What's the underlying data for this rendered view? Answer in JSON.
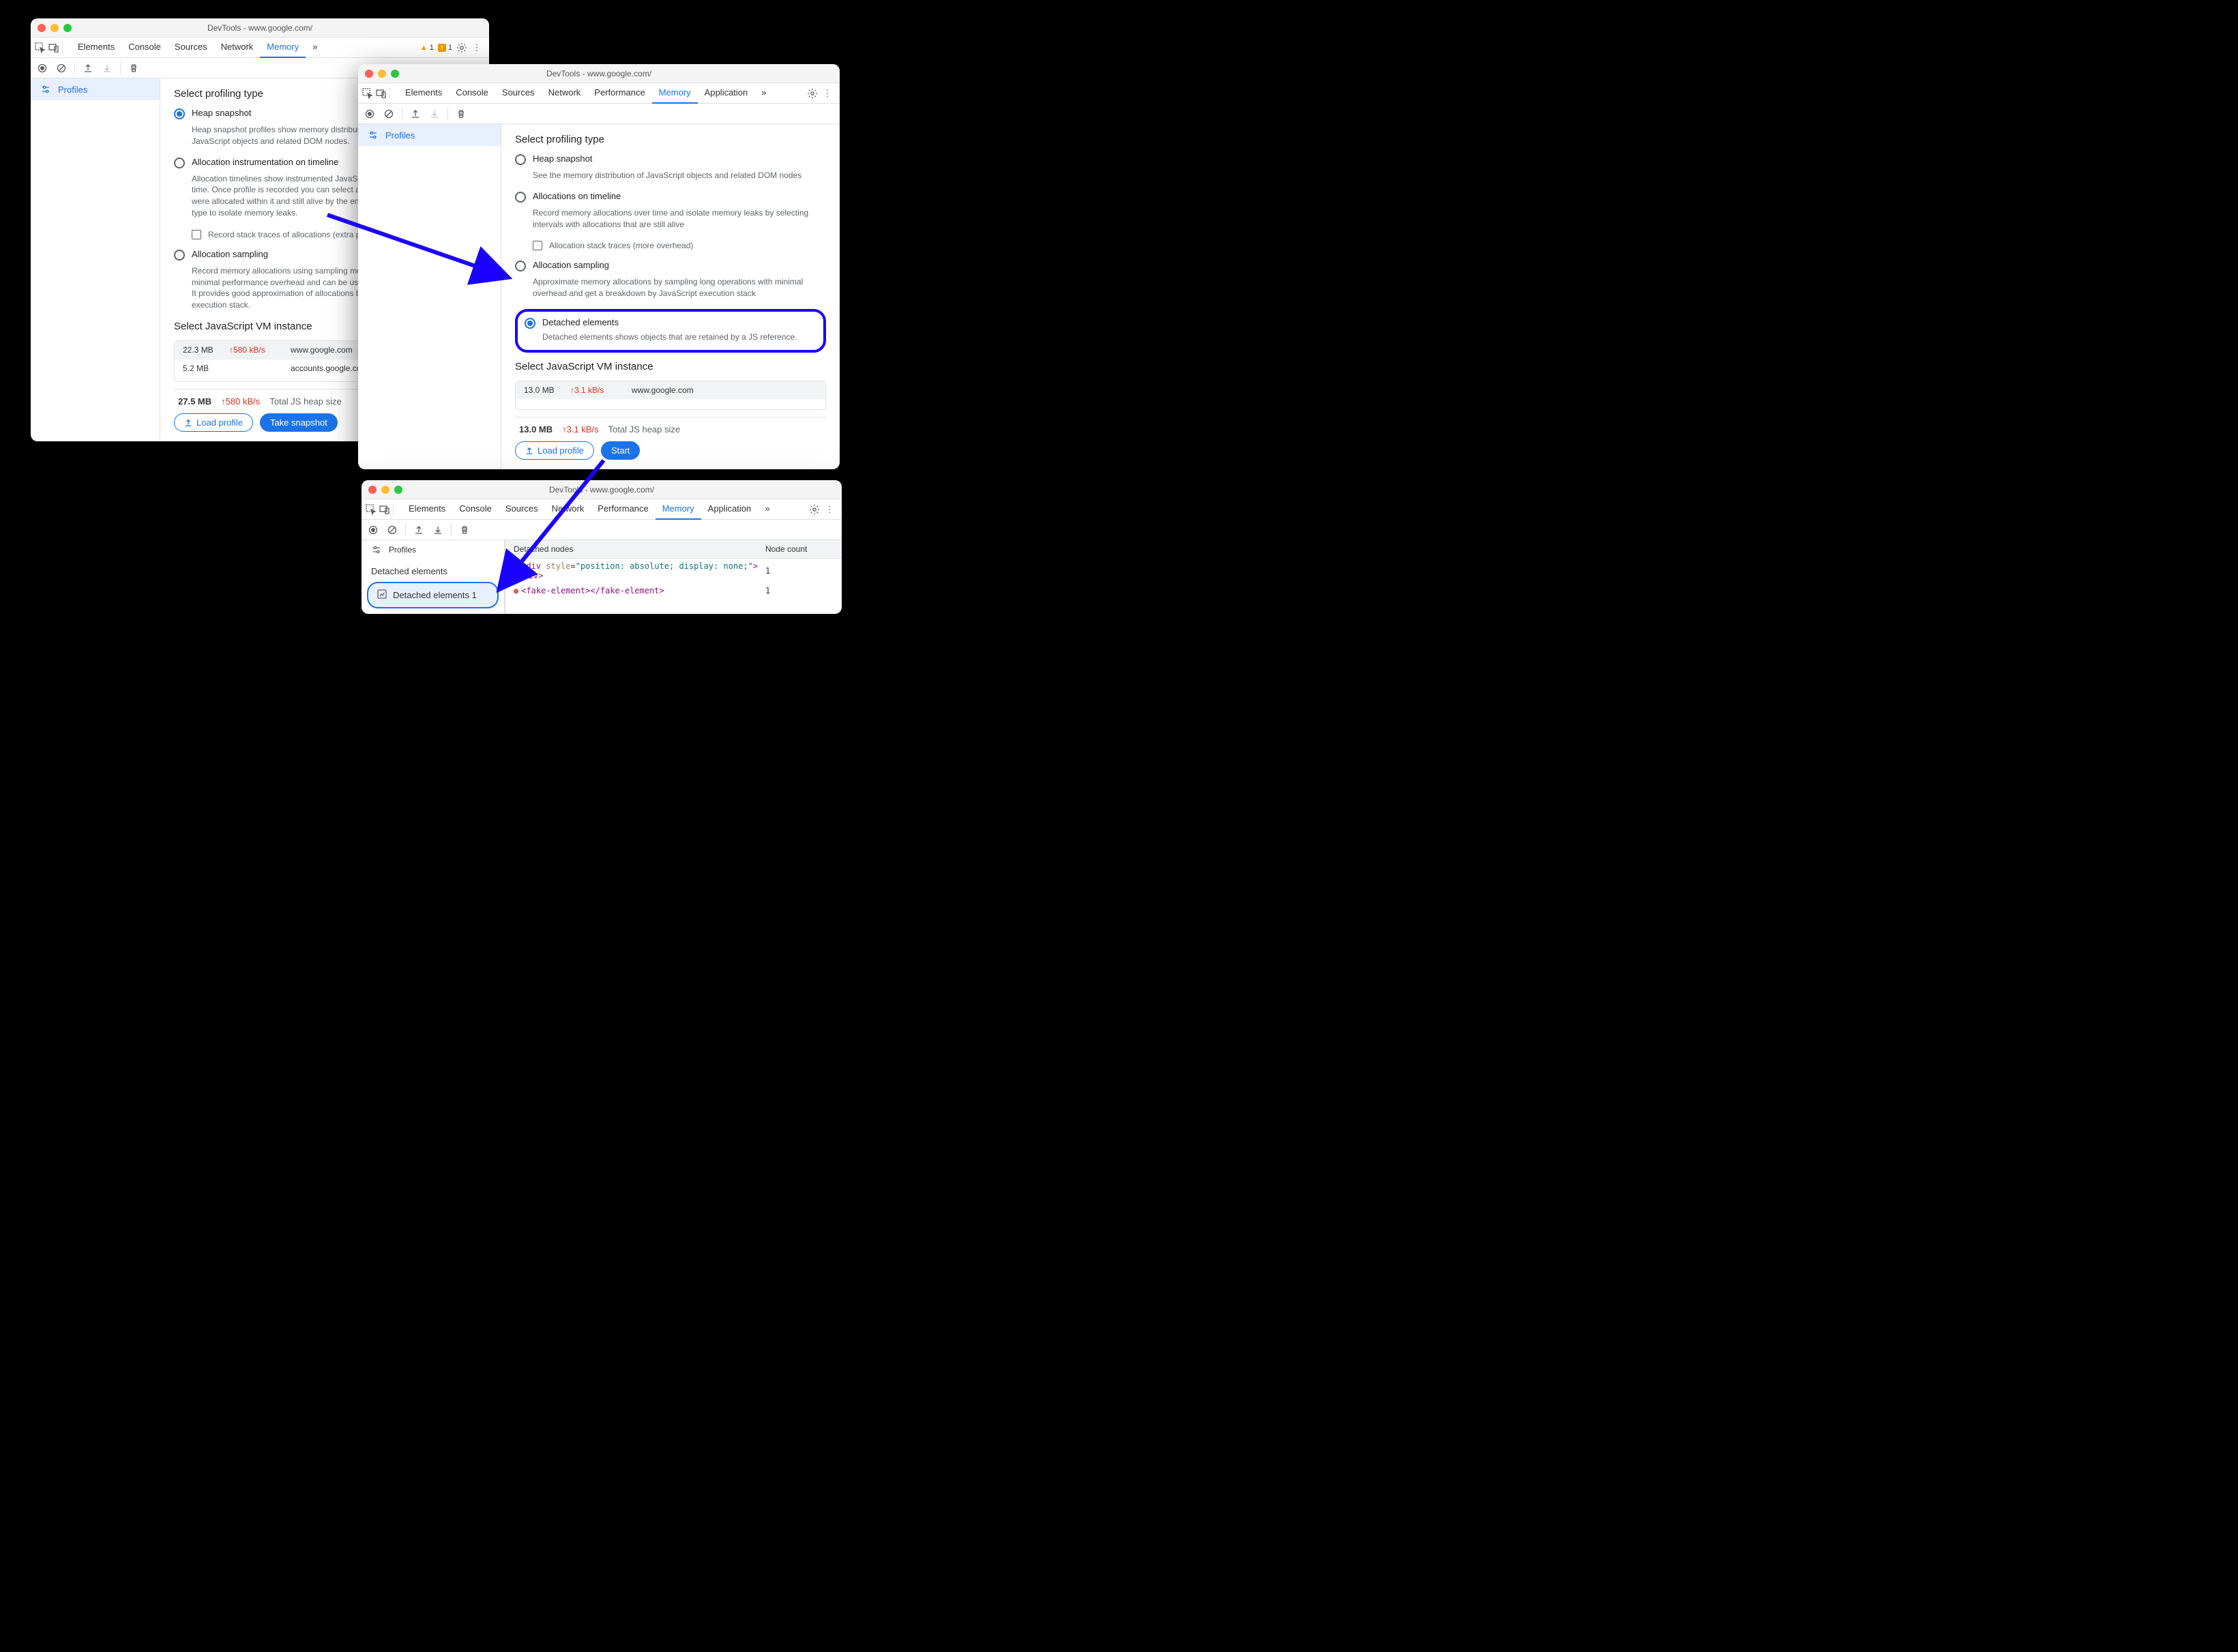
{
  "window_title": "DevTools - www.google.com/",
  "tabs": {
    "elements": "Elements",
    "console": "Console",
    "sources": "Sources",
    "network": "Network",
    "performance": "Performance",
    "memory": "Memory",
    "application": "Application"
  },
  "warnings_count": "1",
  "errors_count": "1",
  "sidebar_profiles": "Profiles",
  "section_profiling": "Select profiling type",
  "w1": {
    "heap_title": "Heap snapshot",
    "heap_desc": "Heap snapshot profiles show memory distribution among your page's JavaScript objects and related DOM nodes.",
    "alloc_title": "Allocation instrumentation on timeline",
    "alloc_desc": "Allocation timelines show instrumented JavaScript memory allocations over time. Once profile is recorded you can select a time interval to see objects that were allocated within it and still alive by the end of recording. Use this profile type to isolate memory leaks.",
    "alloc_check": "Record stack traces of allocations (extra performance overhead)",
    "sampling_title": "Allocation sampling",
    "sampling_desc": "Record memory allocations using sampling method. This profile type has minimal performance overhead and can be used for long running operations. It provides good approximation of allocations broken down by JavaScript execution stack.",
    "vm_title": "Select JavaScript VM instance",
    "vm0_size": "22.3 MB",
    "vm0_rate": "580 kB/s",
    "vm0_host": "www.google.com",
    "vm1_size": "5.2 MB",
    "vm1_rate": "",
    "vm1_host": "accounts.google.com: Ro…",
    "total_size": "27.5 MB",
    "total_rate": "580 kB/s",
    "total_label": "Total JS heap size",
    "load_btn": "Load profile",
    "take_btn": "Take snapshot"
  },
  "w2": {
    "heap_title": "Heap snapshot",
    "heap_desc": "See the memory distribution of JavaScript objects and related DOM nodes",
    "alloc_title": "Allocations on timeline",
    "alloc_desc": "Record memory allocations over time and isolate memory leaks by selecting intervals with allocations that are still alive",
    "alloc_check": "Allocation stack traces (more overhead)",
    "sampling_title": "Allocation sampling",
    "sampling_desc": "Approximate memory allocations by sampling long operations with minimal overhead and get a breakdown by JavaScript execution stack",
    "detached_title": "Detached elements",
    "detached_desc": "Detached elements shows objects that are retained by a JS reference.",
    "vm_title": "Select JavaScript VM instance",
    "vm0_size": "13.0 MB",
    "vm0_rate": "3.1 kB/s",
    "vm0_host": "www.google.com",
    "total_size": "13.0 MB",
    "total_rate": "3.1 kB/s",
    "total_label": "Total JS heap size",
    "load_btn": "Load profile",
    "start_btn": "Start"
  },
  "w3": {
    "sidebar_heading": "Detached elements",
    "snapshot_name": "Detached elements 1",
    "col_detached": "Detached nodes",
    "col_count": "Node count",
    "row1_html": "<div style=\"position: absolute; display: none;\"></div>",
    "row1_count": "1",
    "row2_html": "<fake-element></fake-element>",
    "row2_count": "1"
  }
}
